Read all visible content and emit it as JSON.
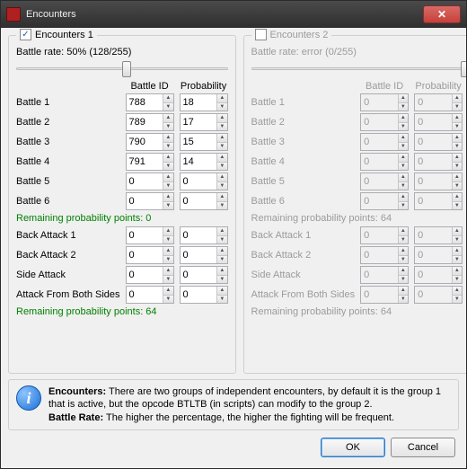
{
  "window": {
    "title": "Encounters"
  },
  "buttons": {
    "ok": "OK",
    "cancel": "Cancel",
    "close": "✕"
  },
  "headers": {
    "battle_id": "Battle ID",
    "probability": "Probability"
  },
  "info": {
    "enc_label": "Encounters:",
    "enc_text": " There are two groups of independent encounters, by default it is the group 1 that is active, but the opcode BTLTB (in scripts) can modify to the group 2.",
    "rate_label": "Battle Rate:",
    "rate_text": " The higher the percentage, the higher the fighting will be frequent."
  },
  "g1": {
    "title": "Encounters 1",
    "checked": true,
    "rate": "Battle rate: 50% (128/255)",
    "thumb_pct": 50,
    "battles": [
      {
        "label": "Battle 1",
        "id": "788",
        "prob": "18"
      },
      {
        "label": "Battle 2",
        "id": "789",
        "prob": "17"
      },
      {
        "label": "Battle 3",
        "id": "790",
        "prob": "15"
      },
      {
        "label": "Battle 4",
        "id": "791",
        "prob": "14"
      },
      {
        "label": "Battle 5",
        "id": "0",
        "prob": "0"
      },
      {
        "label": "Battle 6",
        "id": "0",
        "prob": "0"
      }
    ],
    "remain1": "Remaining probability points: 0",
    "special": [
      {
        "label": "Back Attack 1",
        "id": "0",
        "prob": "0"
      },
      {
        "label": "Back Attack 2",
        "id": "0",
        "prob": "0"
      },
      {
        "label": "Side Attack",
        "id": "0",
        "prob": "0"
      },
      {
        "label": "Attack From Both Sides",
        "id": "0",
        "prob": "0"
      }
    ],
    "remain2": "Remaining probability points: 64"
  },
  "g2": {
    "title": "Encounters 2",
    "checked": false,
    "rate": "Battle rate: error (0/255)",
    "thumb_pct": 99,
    "battles": [
      {
        "label": "Battle 1",
        "id": "0",
        "prob": "0"
      },
      {
        "label": "Battle 2",
        "id": "0",
        "prob": "0"
      },
      {
        "label": "Battle 3",
        "id": "0",
        "prob": "0"
      },
      {
        "label": "Battle 4",
        "id": "0",
        "prob": "0"
      },
      {
        "label": "Battle 5",
        "id": "0",
        "prob": "0"
      },
      {
        "label": "Battle 6",
        "id": "0",
        "prob": "0"
      }
    ],
    "remain1": "Remaining probability points: 64",
    "special": [
      {
        "label": "Back Attack 1",
        "id": "0",
        "prob": "0"
      },
      {
        "label": "Back Attack 2",
        "id": "0",
        "prob": "0"
      },
      {
        "label": "Side Attack",
        "id": "0",
        "prob": "0"
      },
      {
        "label": "Attack From Both Sides",
        "id": "0",
        "prob": "0"
      }
    ],
    "remain2": "Remaining probability points: 64"
  }
}
